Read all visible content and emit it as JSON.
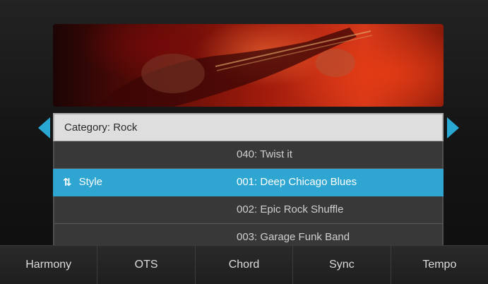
{
  "banner": {
    "image": "rock-guitarist-photo"
  },
  "nav": {
    "left_icon": "triangle-left-icon",
    "right_icon": "triangle-right-icon"
  },
  "list": {
    "category": "Category: Rock",
    "rows": [
      {
        "label": "",
        "value": "040:  Twist it",
        "selected": false
      },
      {
        "label": "Style",
        "value": "001: Deep Chicago Blues",
        "selected": true,
        "icon": "sort-arrows-icon"
      },
      {
        "label": "",
        "value": "002: Epic Rock Shuffle",
        "selected": false
      },
      {
        "label": "",
        "value": "003: Garage Funk Band",
        "selected": false
      }
    ]
  },
  "toolbar": {
    "buttons": [
      "Harmony",
      "OTS",
      "Chord",
      "Sync",
      "Tempo"
    ]
  },
  "colors": {
    "accent": "#2ea6d1",
    "category_bg": "#dedede",
    "row_bg": "#383838"
  }
}
